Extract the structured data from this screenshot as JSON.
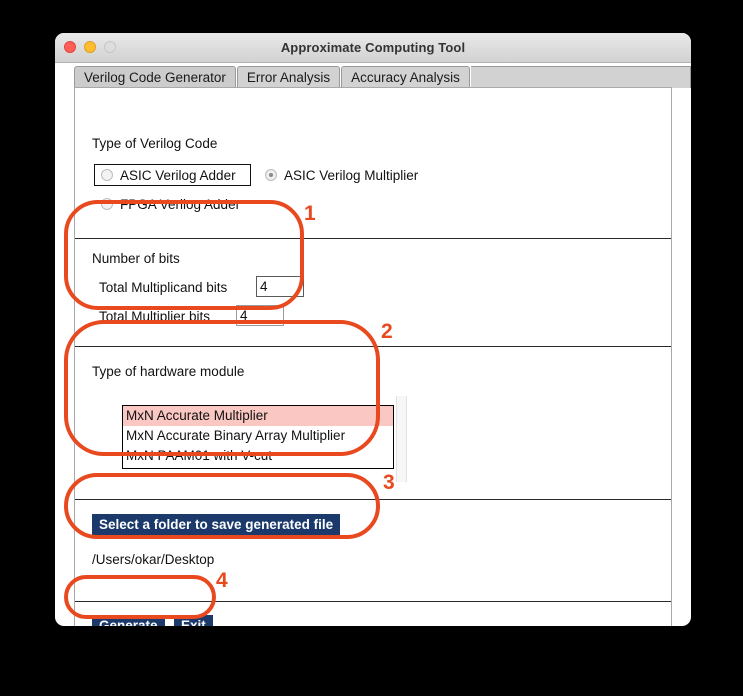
{
  "window": {
    "title": "Approximate Computing Tool",
    "traffic_lights": [
      {
        "name": "close",
        "color": "#ff5f57"
      },
      {
        "name": "minimize",
        "color": "#febc2e"
      },
      {
        "name": "zoom",
        "color": "#dddddd"
      }
    ]
  },
  "tabs": [
    {
      "label": "Verilog Code Generator",
      "active": true
    },
    {
      "label": "Error Analysis",
      "active": false
    },
    {
      "label": "Accuracy Analysis",
      "active": false
    }
  ],
  "code_type": {
    "heading": "Type of Verilog Code",
    "options": [
      {
        "label": "ASIC Verilog Adder",
        "checked": false,
        "focused": true
      },
      {
        "label": "ASIC Verilog Multiplier",
        "checked": true,
        "focused": false
      },
      {
        "label": "FPGA Verilog Adder",
        "checked": false,
        "focused": false
      }
    ]
  },
  "bits": {
    "heading": "Number of bits",
    "fields": [
      {
        "label": "Total Multiplicand bits",
        "value": "4",
        "focused": true
      },
      {
        "label": "Total Multiplier bits",
        "value": "4",
        "focused": false
      }
    ]
  },
  "hardware_module": {
    "heading": "Type of hardware module",
    "items": [
      {
        "label": "MxN Accurate Multiplier",
        "selected": true
      },
      {
        "label": "MxN Accurate Binary Array Multiplier",
        "selected": false
      },
      {
        "label": "MxN PAAM01 with V-cut",
        "selected": false
      }
    ]
  },
  "folder": {
    "button_label": "Select a folder to save generated file",
    "path": "/Users/okar/Desktop"
  },
  "actions": {
    "generate_label": "Generate",
    "exit_label": "Exit"
  },
  "annotations": {
    "color": "#e8491f",
    "markers": [
      {
        "number": "1",
        "target": "number-of-bits-group"
      },
      {
        "number": "2",
        "target": "hardware-module-group"
      },
      {
        "number": "3",
        "target": "folder-selection-group"
      },
      {
        "number": "4",
        "target": "action-buttons-group"
      }
    ]
  }
}
